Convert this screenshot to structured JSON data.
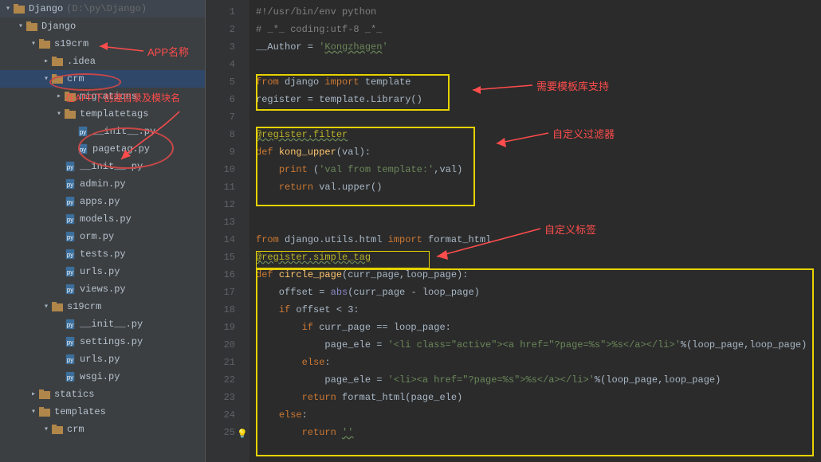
{
  "project": {
    "name": "Django",
    "path": "(D:\\py\\Django)"
  },
  "tree": [
    {
      "indent": 0,
      "arrow": "▾",
      "type": "folder-root",
      "label": "Django"
    },
    {
      "indent": 1,
      "arrow": "▾",
      "type": "folder",
      "label": "Django"
    },
    {
      "indent": 2,
      "arrow": "▾",
      "type": "folder",
      "label": "s19crm"
    },
    {
      "indent": 3,
      "arrow": "▸",
      "type": "folder",
      "label": ".idea"
    },
    {
      "indent": 3,
      "arrow": "▾",
      "type": "folder",
      "label": "crm",
      "selected": true
    },
    {
      "indent": 4,
      "arrow": "▸",
      "type": "folder",
      "label": "migrations"
    },
    {
      "indent": 4,
      "arrow": "▾",
      "type": "folder",
      "label": "templatetags"
    },
    {
      "indent": 5,
      "arrow": "",
      "type": "py",
      "label": "__init__.py"
    },
    {
      "indent": 5,
      "arrow": "",
      "type": "py",
      "label": "pagetag.py"
    },
    {
      "indent": 4,
      "arrow": "",
      "type": "py",
      "label": "__init__.py"
    },
    {
      "indent": 4,
      "arrow": "",
      "type": "py",
      "label": "admin.py"
    },
    {
      "indent": 4,
      "arrow": "",
      "type": "py",
      "label": "apps.py"
    },
    {
      "indent": 4,
      "arrow": "",
      "type": "py",
      "label": "models.py"
    },
    {
      "indent": 4,
      "arrow": "",
      "type": "py",
      "label": "orm.py"
    },
    {
      "indent": 4,
      "arrow": "",
      "type": "py",
      "label": "tests.py"
    },
    {
      "indent": 4,
      "arrow": "",
      "type": "py",
      "label": "urls.py"
    },
    {
      "indent": 4,
      "arrow": "",
      "type": "py",
      "label": "views.py"
    },
    {
      "indent": 3,
      "arrow": "▾",
      "type": "folder",
      "label": "s19crm"
    },
    {
      "indent": 4,
      "arrow": "",
      "type": "py",
      "label": "__init__.py"
    },
    {
      "indent": 4,
      "arrow": "",
      "type": "py",
      "label": "settings.py"
    },
    {
      "indent": 4,
      "arrow": "",
      "type": "py",
      "label": "urls.py"
    },
    {
      "indent": 4,
      "arrow": "",
      "type": "py",
      "label": "wsgi.py"
    },
    {
      "indent": 2,
      "arrow": "▸",
      "type": "folder",
      "label": "statics"
    },
    {
      "indent": 2,
      "arrow": "▾",
      "type": "folder",
      "label": "templates"
    },
    {
      "indent": 3,
      "arrow": "▾",
      "type": "folder",
      "label": "crm"
    }
  ],
  "line_numbers": [
    "1",
    "2",
    "3",
    "4",
    "5",
    "6",
    "7",
    "8",
    "9",
    "10",
    "11",
    "12",
    "13",
    "14",
    "15",
    "16",
    "17",
    "18",
    "19",
    "20",
    "21",
    "22",
    "23",
    "24",
    "25"
  ],
  "code_lines": [
    [
      {
        "c": "cm",
        "t": "#!/usr/bin/env python"
      }
    ],
    [
      {
        "c": "cm",
        "t": "# _*_ coding:utf-8 _*_"
      }
    ],
    [
      {
        "c": "",
        "t": "__Author = "
      },
      {
        "c": "str",
        "t": "'"
      },
      {
        "c": "str underline",
        "t": "Kongzhagen"
      },
      {
        "c": "str",
        "t": "'"
      }
    ],
    [],
    [
      {
        "c": "kw",
        "t": "from"
      },
      {
        "c": "",
        "t": " django "
      },
      {
        "c": "kw",
        "t": "import"
      },
      {
        "c": "",
        "t": " template"
      }
    ],
    [
      {
        "c": "",
        "t": "register = template.Library()"
      }
    ],
    [],
    [
      {
        "c": "dec underline",
        "t": "@register.filter"
      }
    ],
    [
      {
        "c": "kw",
        "t": "def "
      },
      {
        "c": "fn",
        "t": "kong_upper"
      },
      {
        "c": "",
        "t": "(val):"
      }
    ],
    [
      {
        "c": "",
        "t": "    "
      },
      {
        "c": "kw",
        "t": "print"
      },
      {
        "c": "",
        "t": " ("
      },
      {
        "c": "str",
        "t": "'val from template:'"
      },
      {
        "c": "",
        "t": ",val)"
      }
    ],
    [
      {
        "c": "",
        "t": "    "
      },
      {
        "c": "kw",
        "t": "return"
      },
      {
        "c": "",
        "t": " val.upper()"
      }
    ],
    [],
    [],
    [
      {
        "c": "kw",
        "t": "from"
      },
      {
        "c": "",
        "t": " django.utils.html "
      },
      {
        "c": "kw",
        "t": "import"
      },
      {
        "c": "",
        "t": " format_html"
      }
    ],
    [
      {
        "c": "dec underline",
        "t": "@register.simple_tag"
      }
    ],
    [
      {
        "c": "kw",
        "t": "def "
      },
      {
        "c": "fn",
        "t": "circle_page"
      },
      {
        "c": "",
        "t": "(curr_page,loop_page):"
      }
    ],
    [
      {
        "c": "",
        "t": "    offset = "
      },
      {
        "c": "builtin",
        "t": "abs"
      },
      {
        "c": "",
        "t": "(curr_page - loop_page)"
      }
    ],
    [
      {
        "c": "",
        "t": "    "
      },
      {
        "c": "kw",
        "t": "if"
      },
      {
        "c": "",
        "t": " offset < "
      },
      {
        "c": "",
        "t": "3:"
      }
    ],
    [
      {
        "c": "",
        "t": "        "
      },
      {
        "c": "kw",
        "t": "if"
      },
      {
        "c": "",
        "t": " curr_page == loop_page:"
      }
    ],
    [
      {
        "c": "",
        "t": "            page_ele = "
      },
      {
        "c": "str",
        "t": "'<li class=\"active\"><a href=\"?page=%s\">%s</a></li>'"
      },
      {
        "c": "",
        "t": "%(loop_page,loop_page)"
      }
    ],
    [
      {
        "c": "",
        "t": "        "
      },
      {
        "c": "kw",
        "t": "else"
      },
      {
        "c": "",
        "t": ":"
      }
    ],
    [
      {
        "c": "",
        "t": "            page_ele = "
      },
      {
        "c": "str",
        "t": "'<li><a href=\"?page=%s\">%s</a></li>'"
      },
      {
        "c": "",
        "t": "%(loop_page,loop_page)"
      }
    ],
    [
      {
        "c": "",
        "t": "        "
      },
      {
        "c": "kw",
        "t": "return"
      },
      {
        "c": "",
        "t": " format_html(page_ele)"
      }
    ],
    [
      {
        "c": "",
        "t": "    "
      },
      {
        "c": "kw",
        "t": "else"
      },
      {
        "c": "",
        "t": ":"
      }
    ],
    [
      {
        "c": "",
        "t": "        "
      },
      {
        "c": "kw",
        "t": "return "
      },
      {
        "c": "str underline",
        "t": "''"
      }
    ]
  ],
  "annotations": {
    "app_name": "APP名称",
    "under_app": "在APP下创建目录及模块名",
    "need_template": "需要模板库支持",
    "custom_filter": "自定义过滤器",
    "custom_tag": "自定义标签"
  }
}
